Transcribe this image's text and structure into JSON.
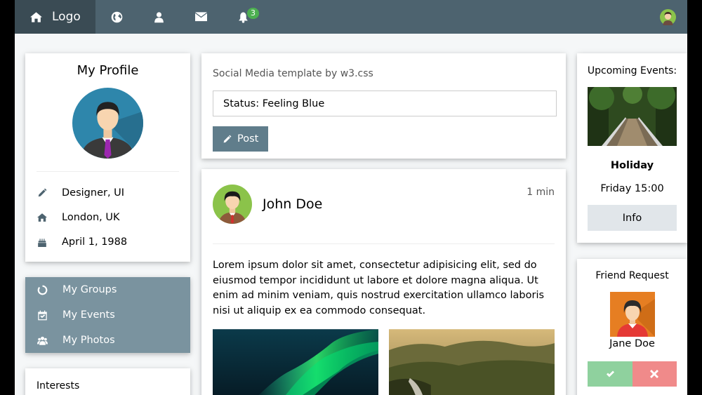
{
  "nav": {
    "logo_label": "Logo",
    "notification_count": "3"
  },
  "profile": {
    "title": "My Profile",
    "role": "Designer, UI",
    "location": "London, UK",
    "birthday": "April 1, 1988"
  },
  "menu": {
    "groups": "My Groups",
    "events": "My Events",
    "photos": "My Photos"
  },
  "interests": {
    "title": "Interests"
  },
  "status": {
    "caption": "Social Media template by w3.css",
    "value": "Status: Feeling Blue",
    "post_label": "Post"
  },
  "post": {
    "author": "John Doe",
    "time": "1 min",
    "text": "Lorem ipsum dolor sit amet, consectetur adipisicing elit, sed do eiusmod tempor incididunt ut labore et dolore magna aliqua. Ut enim ad minim veniam, quis nostrud exercitation ullamco laboris nisi ut aliquip ex ea commodo consequat."
  },
  "events": {
    "title": "Upcoming Events:",
    "name": "Holiday",
    "time": "Friday 15:00",
    "info_label": "Info"
  },
  "friend_request": {
    "title": "Friend Request",
    "name": "Jane Doe"
  },
  "colors": {
    "topbar": "#4d636f",
    "topbar_active": "#3a4b54",
    "menu": "#7a939f",
    "button": "#607d8b",
    "accept": "#8fd19e",
    "decline": "#f08a8a",
    "badge": "#4caf50"
  },
  "icons": [
    "home-icon",
    "globe-icon",
    "user-icon",
    "envelope-icon",
    "bell-icon",
    "pencil-icon",
    "birthday-cake-icon",
    "circle-notch-icon",
    "calendar-check-icon",
    "users-icon",
    "check-icon",
    "times-icon"
  ]
}
